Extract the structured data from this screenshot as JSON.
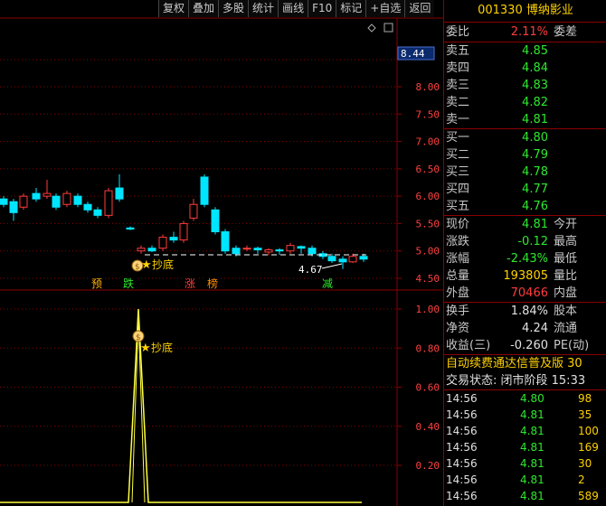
{
  "toolbar": [
    "复权",
    "叠加",
    "多股",
    "统计",
    "画线",
    "F10",
    "标记",
    "+自选",
    "返回"
  ],
  "price_axis": [
    "8.00",
    "7.50",
    "7.00",
    "6.50",
    "6.00",
    "5.50",
    "5.00",
    "4.50"
  ],
  "price_marker": "8.44",
  "indicator_axis": [
    "1.00",
    "0.80",
    "0.60",
    "0.40",
    "0.20"
  ],
  "low_annotation": "4.67",
  "signals": {
    "bottom_label": "抄底",
    "indicator_label": "抄底",
    "markers": [
      "预",
      "跌",
      "涨",
      "榜",
      "减"
    ]
  },
  "colors": {
    "up": "#ff3c3c",
    "down": "#00e5ff",
    "green": "#2ee82e",
    "yellow": "#ffd200",
    "border": "#8b0000"
  },
  "quote": {
    "code": "001330",
    "name": "博纳影业",
    "weibi_label": "委比",
    "weibi_value": "2.11%",
    "weicha_label": "委差",
    "sells": [
      {
        "label": "卖五",
        "price": "4.85"
      },
      {
        "label": "卖四",
        "price": "4.84"
      },
      {
        "label": "卖三",
        "price": "4.83"
      },
      {
        "label": "卖二",
        "price": "4.82"
      },
      {
        "label": "卖一",
        "price": "4.81"
      }
    ],
    "buys": [
      {
        "label": "买一",
        "price": "4.80"
      },
      {
        "label": "买二",
        "price": "4.79"
      },
      {
        "label": "买三",
        "price": "4.78"
      },
      {
        "label": "买四",
        "price": "4.77"
      },
      {
        "label": "买五",
        "price": "4.76"
      }
    ],
    "stats": [
      {
        "label": "现价",
        "value": "4.81",
        "label2": "今开",
        "color": "green"
      },
      {
        "label": "涨跌",
        "value": "-0.12",
        "label2": "最高",
        "color": "green"
      },
      {
        "label": "涨幅",
        "value": "-2.43%",
        "label2": "最低",
        "color": "green"
      },
      {
        "label": "总量",
        "value": "193805",
        "label2": "量比",
        "color": "yellow"
      },
      {
        "label": "外盘",
        "value": "70466",
        "label2": "内盘",
        "color": "red"
      }
    ],
    "stats2": [
      {
        "label": "换手",
        "value": "1.84%",
        "label2": "股本"
      },
      {
        "label": "净资",
        "value": "4.24",
        "label2": "流通"
      },
      {
        "label": "收益(三)",
        "value": "-0.260",
        "label2": "PE(动)"
      }
    ],
    "ad_text": "自动续费通达信普及版 30",
    "trade_status": "交易状态: 闭市阶段 15:33",
    "ticks": [
      {
        "time": "14:56",
        "price": "4.80",
        "vol": "98"
      },
      {
        "time": "14:56",
        "price": "4.81",
        "vol": "35"
      },
      {
        "time": "14:56",
        "price": "4.81",
        "vol": "100"
      },
      {
        "time": "14:56",
        "price": "4.81",
        "vol": "169"
      },
      {
        "time": "14:56",
        "price": "4.81",
        "vol": "30"
      },
      {
        "time": "14:56",
        "price": "4.81",
        "vol": "2"
      },
      {
        "time": "14:56",
        "price": "4.81",
        "vol": "589"
      }
    ]
  }
}
